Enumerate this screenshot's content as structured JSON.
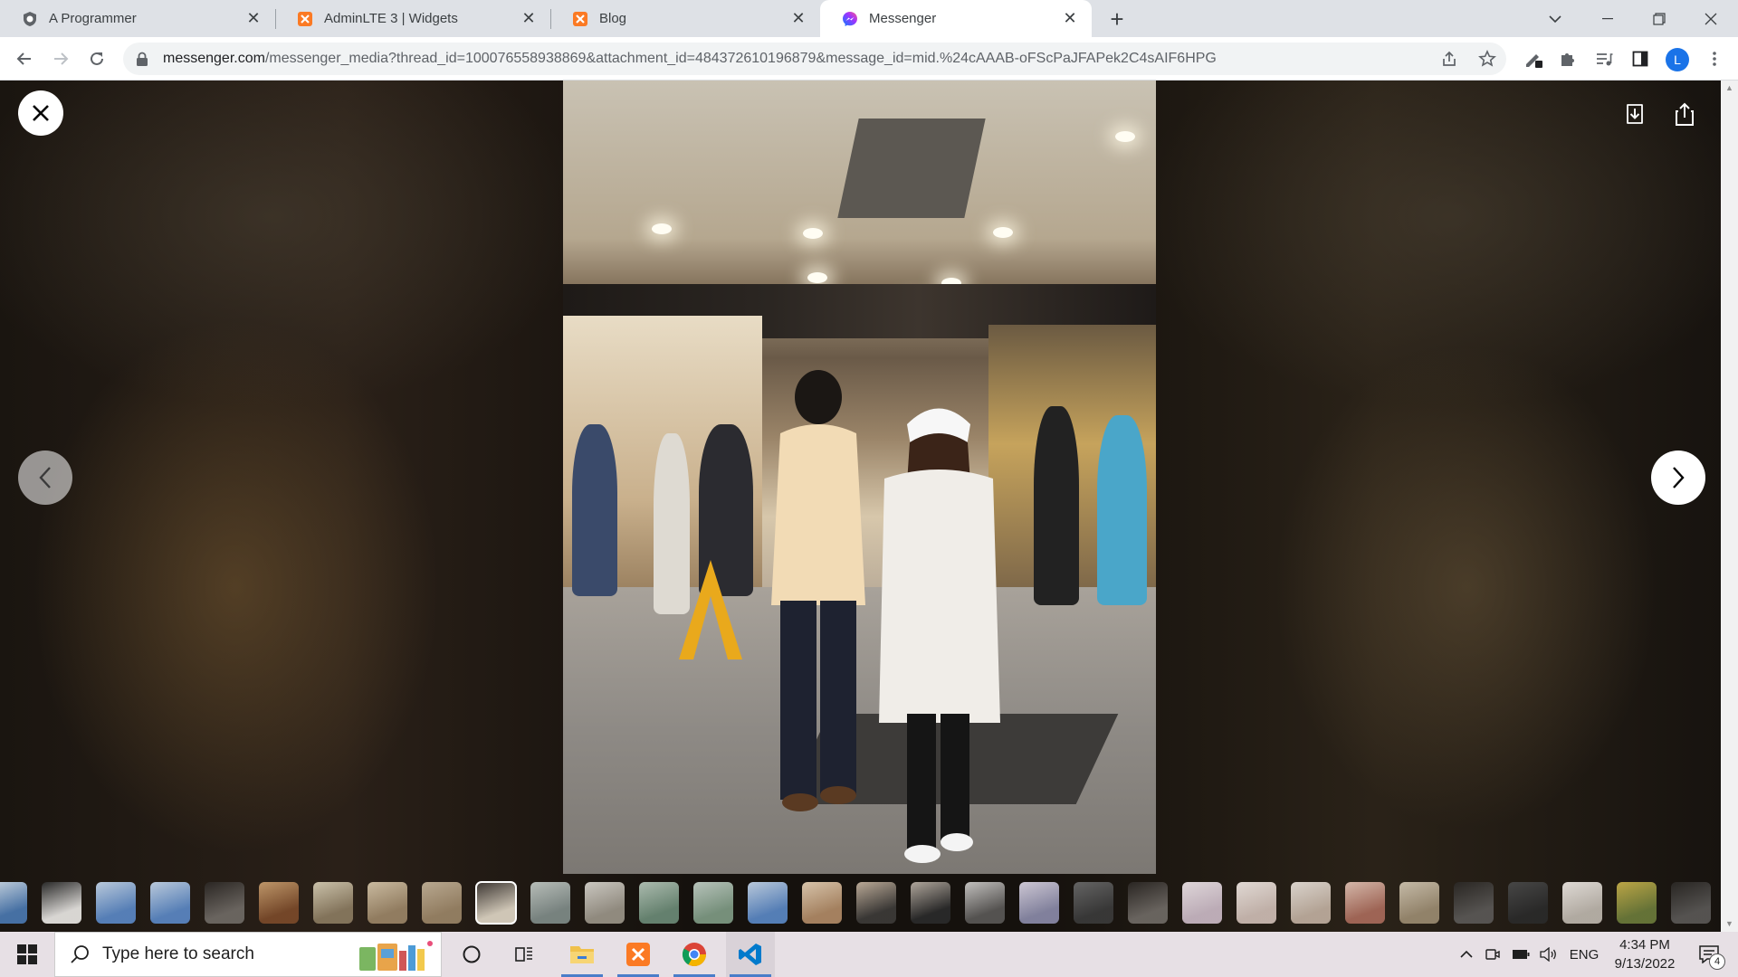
{
  "browser": {
    "tabs": [
      {
        "label": "A Programmer",
        "icon": "shield-globe-icon",
        "active": false
      },
      {
        "label": "AdminLTE 3 | Widgets",
        "icon": "xampp-icon",
        "active": false
      },
      {
        "label": "Blog",
        "icon": "xampp-icon",
        "active": false
      },
      {
        "label": "Messenger",
        "icon": "messenger-icon",
        "active": true
      }
    ],
    "url": {
      "host": "messenger.com",
      "path": "/messenger_media?thread_id=100076558938869&attachment_id=484372610196879&message_id=mid.%24cAAAB-oFScPaJFAPek2C4sAIF6HPG"
    },
    "profile_initial": "L"
  },
  "viewer": {
    "thumbnail_count": 32,
    "selected_thumbnail_index": 9,
    "photo_description_icon": "shopping-mall-photo"
  },
  "taskbar": {
    "search_placeholder": "Type here to search",
    "language": "ENG",
    "time": "4:34 PM",
    "date": "9/13/2022",
    "notification_count": "4"
  },
  "colors": {
    "accent": "#1a73e8",
    "tabstrip": "#dee1e6",
    "taskbar": "#e7e0e5",
    "xampp_orange": "#fb7a24",
    "vscode_blue": "#007acc"
  }
}
